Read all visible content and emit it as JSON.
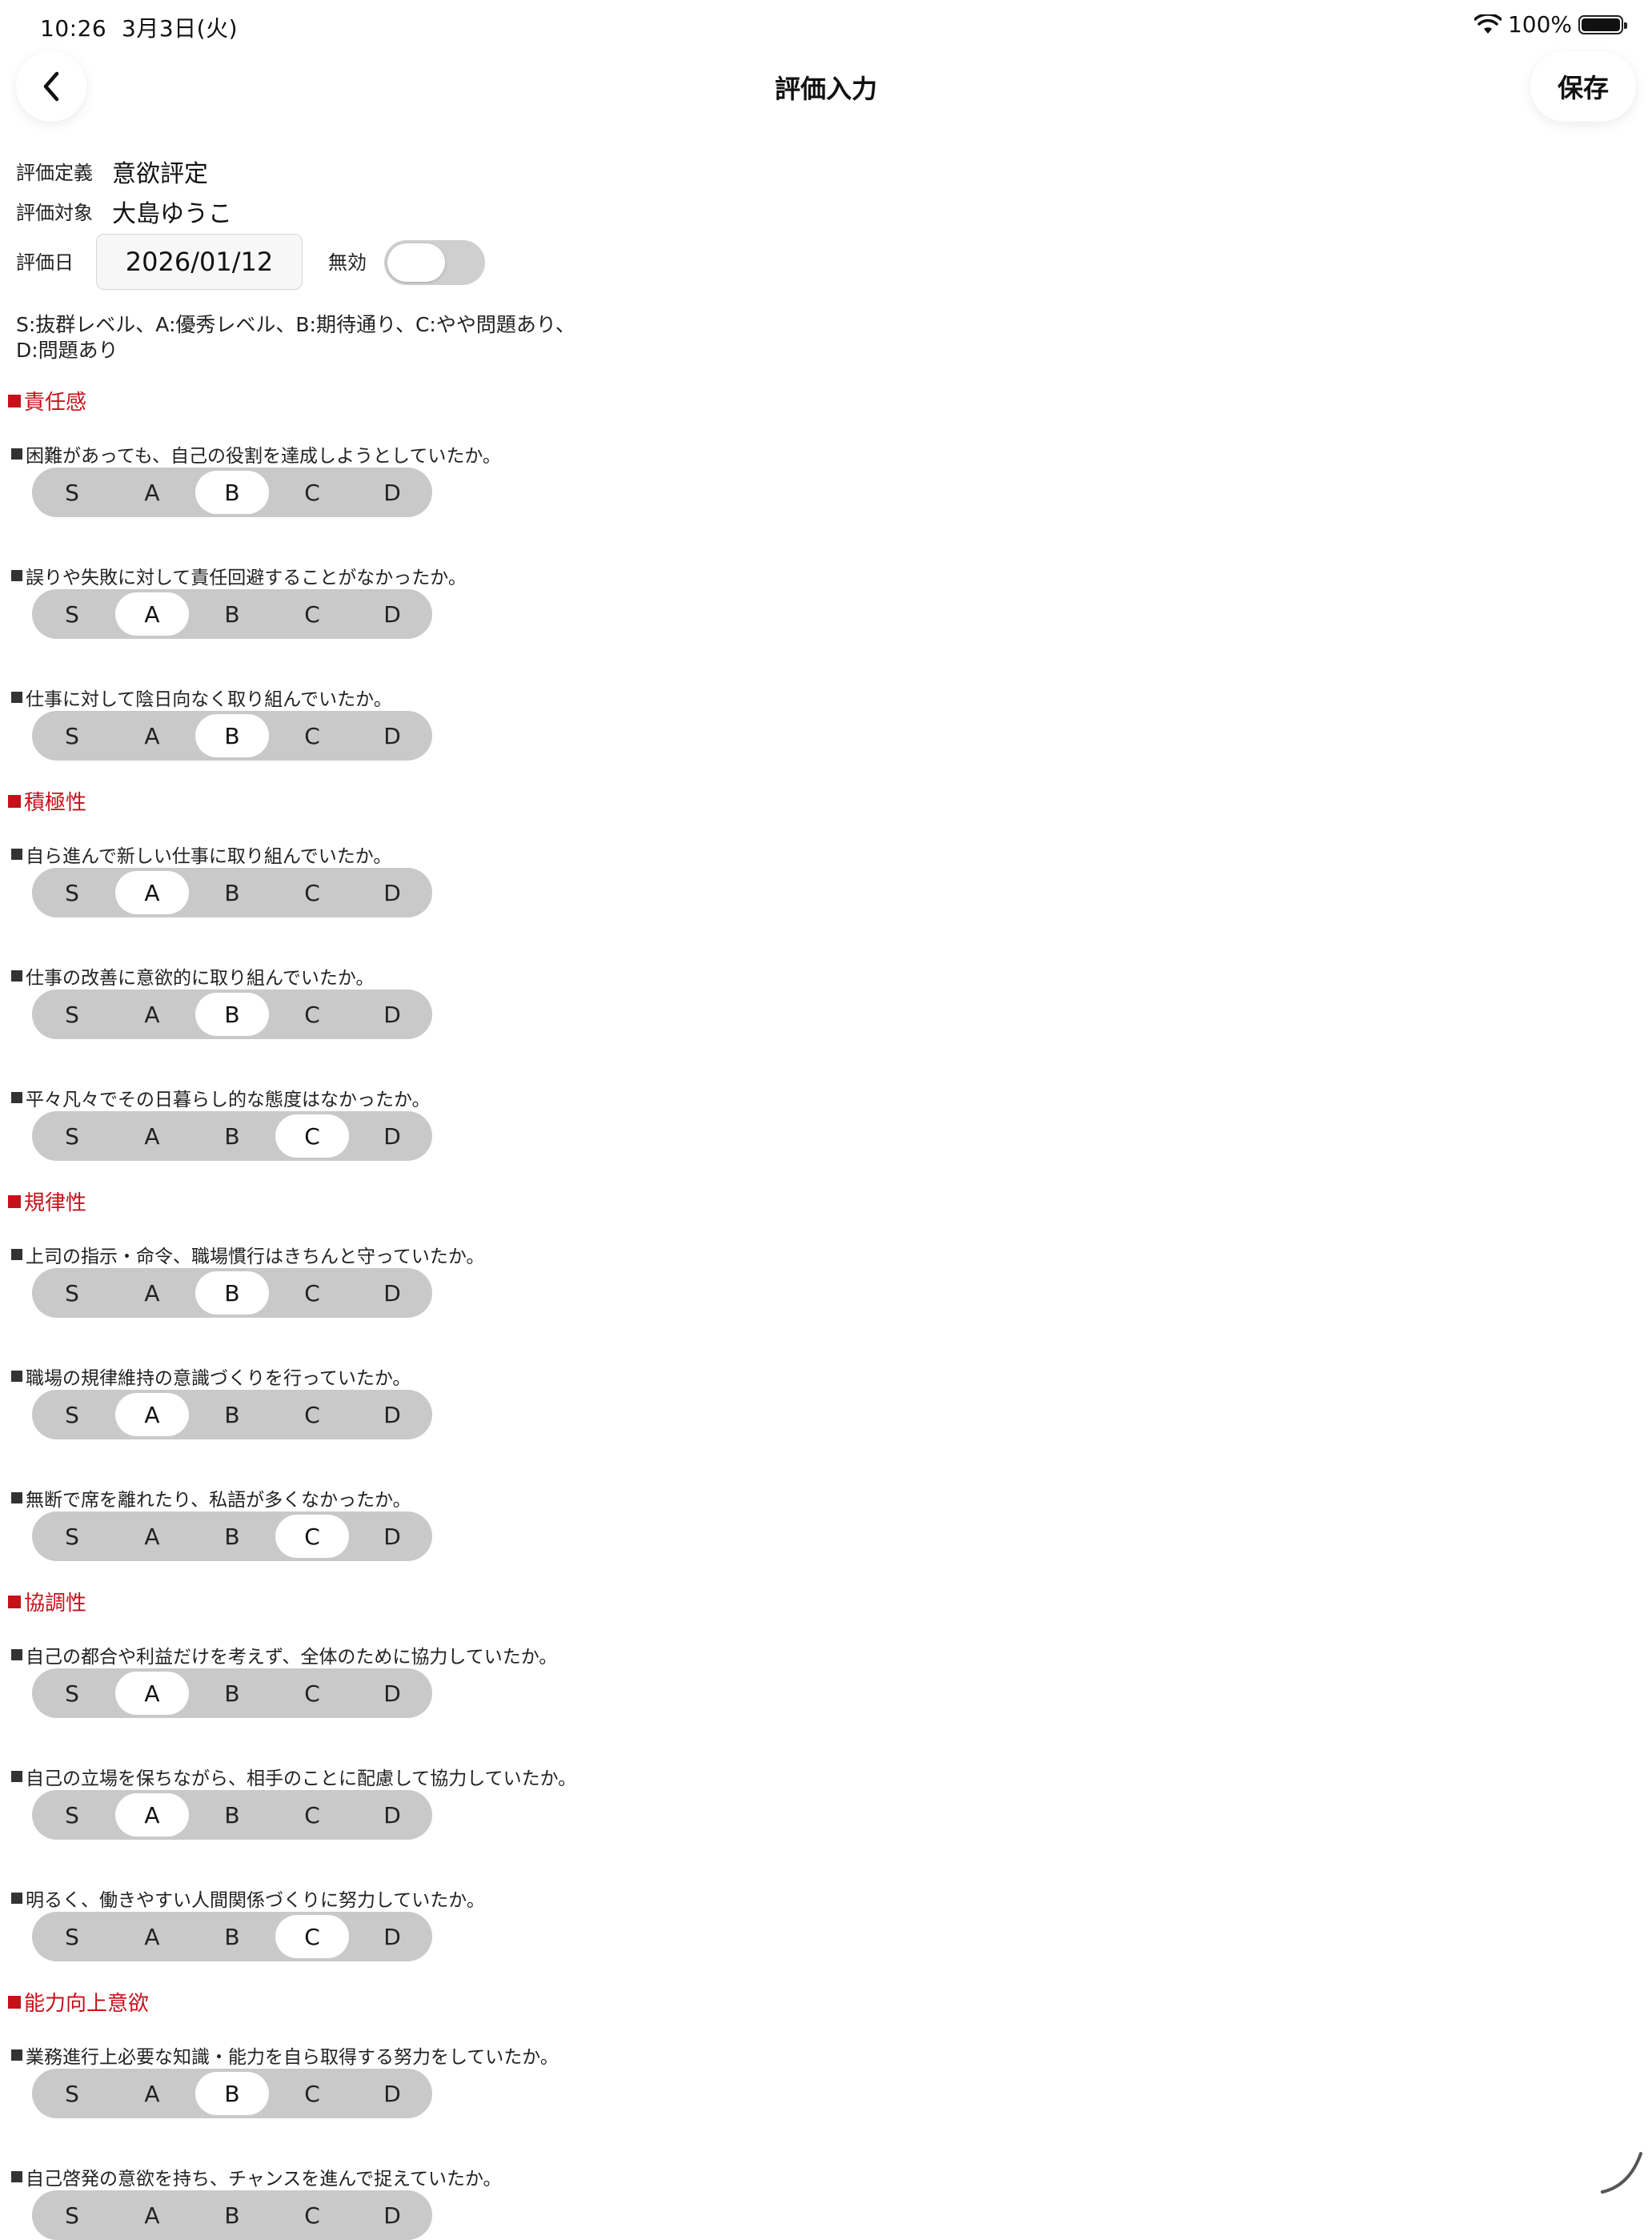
{
  "status_bar": {
    "time": "10:26",
    "date": "3月3日(火)",
    "battery": "100%"
  },
  "header": {
    "title": "評価入力",
    "save_label": "保存"
  },
  "info": {
    "definition_label": "評価定義",
    "definition_value": "意欲評定",
    "target_label": "評価対象",
    "target_value": "大島ゆうこ",
    "date_label": "評価日",
    "date_value": "2026/01/12",
    "invalid_label": "無効",
    "invalid_enabled": false
  },
  "legend_text": "S:抜群レベル、A:優秀レベル、B:期待通り、C:やや問題あり、D:問題あり",
  "options": [
    "S",
    "A",
    "B",
    "C",
    "D"
  ],
  "sections": [
    {
      "title": "責任感",
      "questions": [
        {
          "text": "困難があっても、自己の役割を達成しようとしていたか。",
          "selected": "B"
        },
        {
          "text": "誤りや失敗に対して責任回避することがなかったか。",
          "selected": "A"
        },
        {
          "text": "仕事に対して陰日向なく取り組んでいたか。",
          "selected": "B"
        }
      ]
    },
    {
      "title": "積極性",
      "questions": [
        {
          "text": "自ら進んで新しい仕事に取り組んでいたか。",
          "selected": "A"
        },
        {
          "text": "仕事の改善に意欲的に取り組んでいたか。",
          "selected": "B"
        },
        {
          "text": "平々凡々でその日暮らし的な態度はなかったか。",
          "selected": "C"
        }
      ]
    },
    {
      "title": "規律性",
      "questions": [
        {
          "text": "上司の指示・命令、職場慣行はきちんと守っていたか。",
          "selected": "B"
        },
        {
          "text": "職場の規律維持の意識づくりを行っていたか。",
          "selected": "A"
        },
        {
          "text": "無断で席を離れたり、私語が多くなかったか。",
          "selected": "C"
        }
      ]
    },
    {
      "title": "協調性",
      "questions": [
        {
          "text": "自己の都合や利益だけを考えず、全体のために協力していたか。",
          "selected": "A"
        },
        {
          "text": "自己の立場を保ちながら、相手のことに配慮して協力していたか。",
          "selected": "A"
        },
        {
          "text": "明るく、働きやすい人間関係づくりに努力していたか。",
          "selected": "C"
        }
      ]
    },
    {
      "title": "能力向上意欲",
      "questions": [
        {
          "text": "業務進行上必要な知識・能力を自ら取得する努力をしていたか。",
          "selected": "B"
        },
        {
          "text": "自己啓発の意欲を持ち、チャンスを進んで捉えていたか。",
          "selected": ""
        }
      ]
    }
  ]
}
